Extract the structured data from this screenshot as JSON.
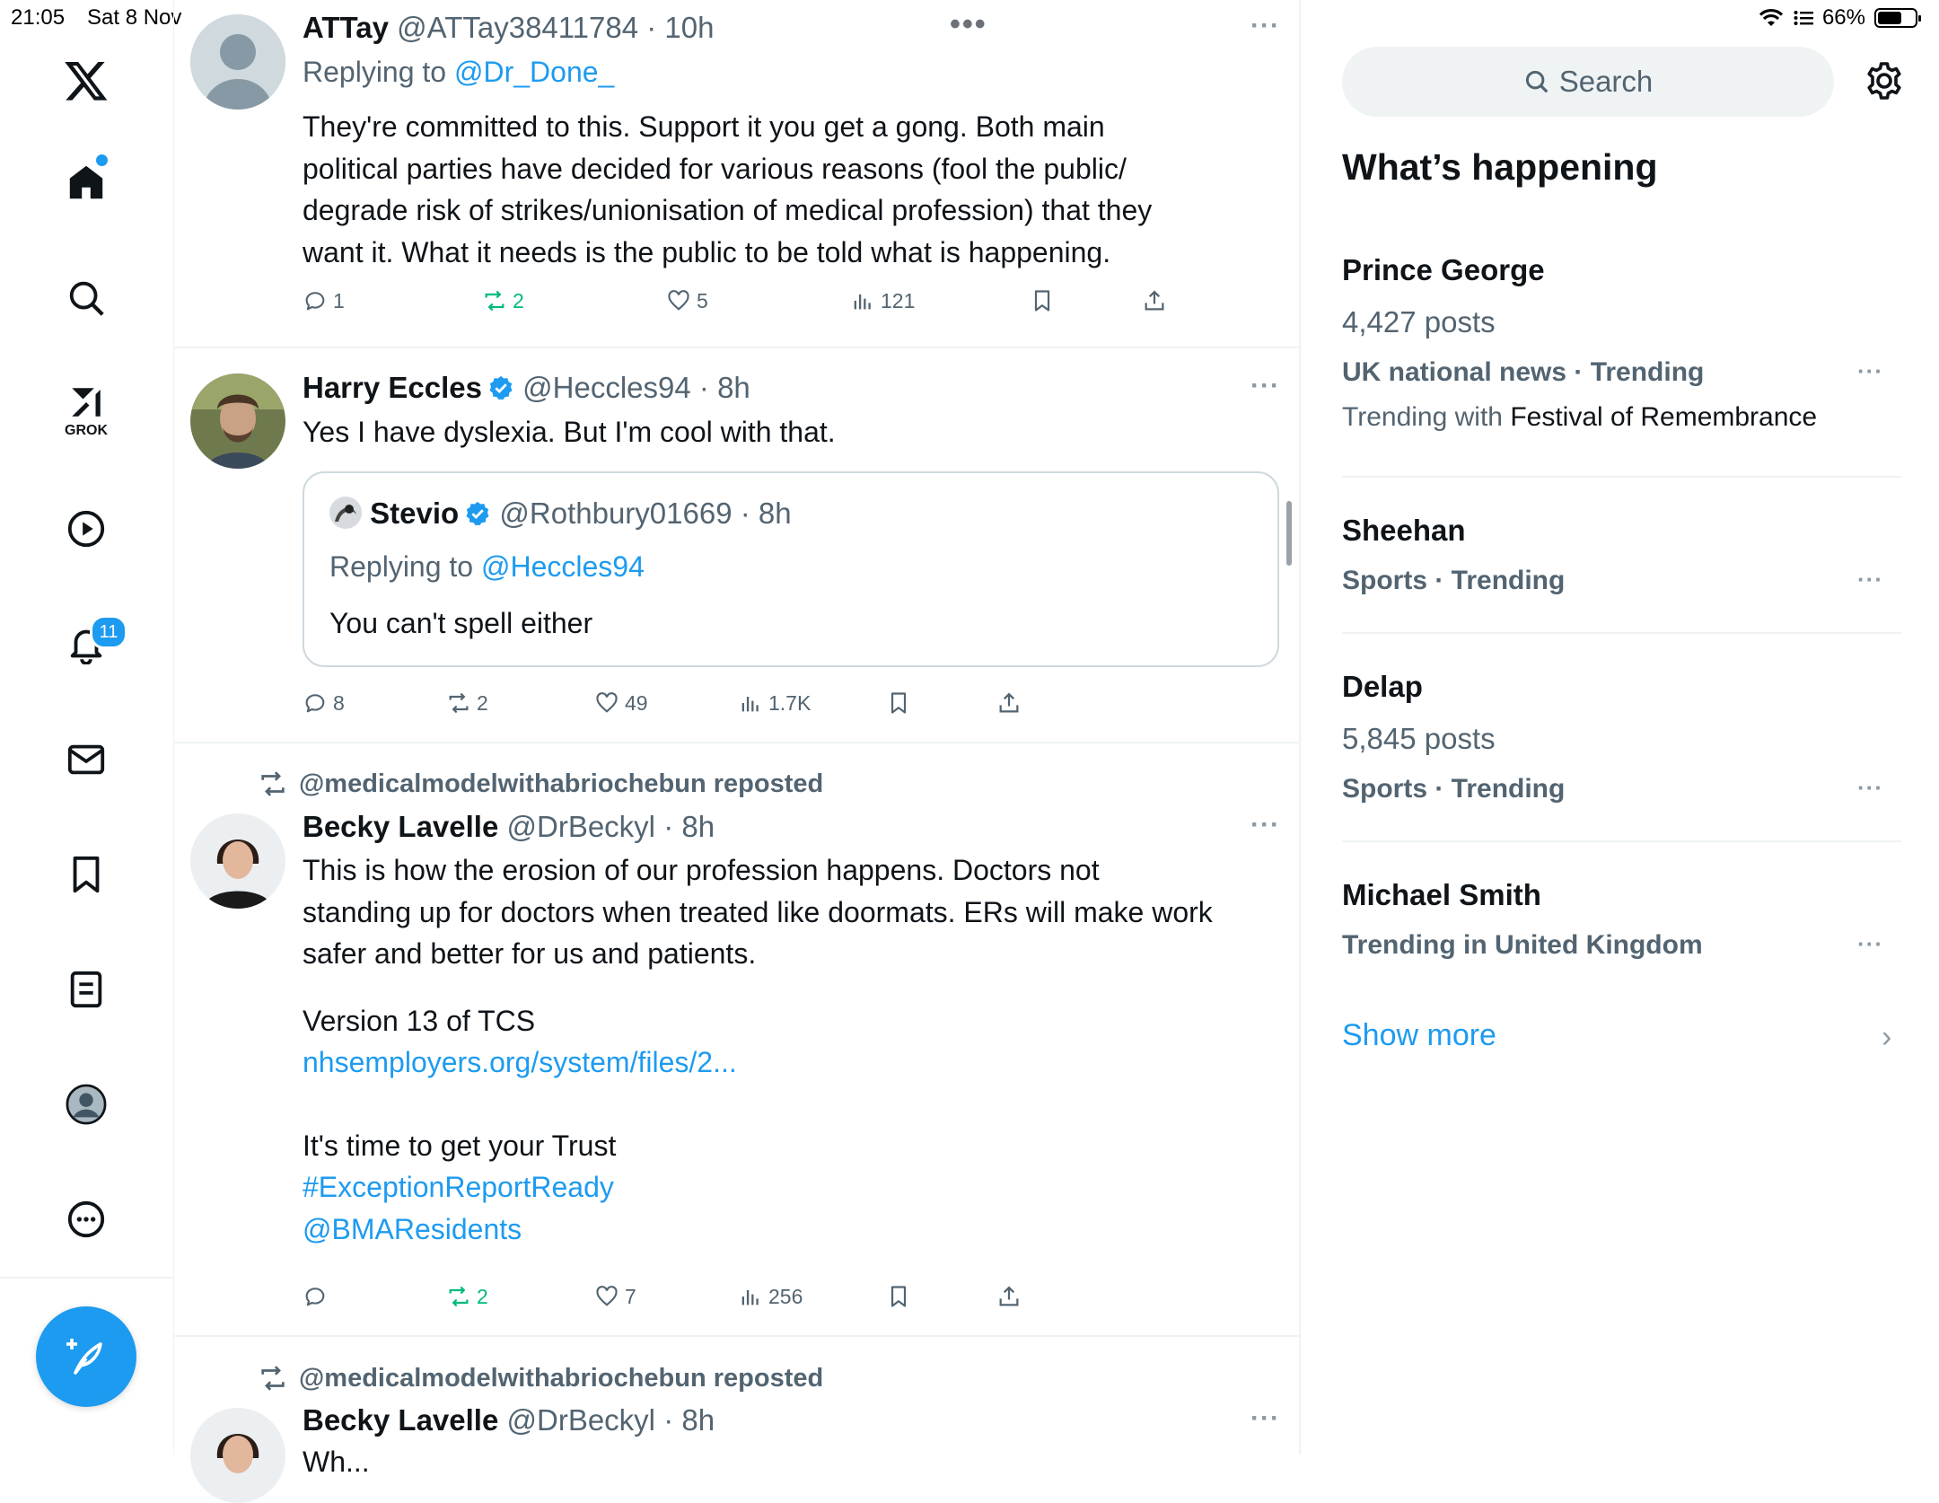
{
  "status": {
    "time": "21:05",
    "date": "Sat 8 Nov",
    "battery": "66%"
  },
  "top_more": "•••",
  "nav": {
    "grok_label": "GROK",
    "notifications_badge": "11"
  },
  "posts": [
    {
      "name": "ATTay",
      "handle": "@ATTay38411784",
      "time": "· 10h",
      "reply_prefix": "Replying to ",
      "reply_to": "@Dr_Done_",
      "lines": [
        "They're committed to this.  Support it you get a gong. Both main",
        "political parties have decided for various reasons (fool the public/",
        "degrade risk of strikes/unionisation of medical profession) that they",
        "want it.  What it needs is the public to be told what is happening."
      ],
      "replies": "1",
      "reposts": "2",
      "likes": "5",
      "views": "121"
    },
    {
      "name": "Harry Eccles",
      "handle": "@Heccles94",
      "time": "· 8h",
      "text": "Yes I have dyslexia. But I'm cool with that.",
      "quote": {
        "name": "Stevio",
        "handle": "@Rothbury01669",
        "time": "· 8h",
        "reply_prefix": "Replying to ",
        "reply_to": "@Heccles94",
        "text": "You can't spell either"
      },
      "replies": "8",
      "reposts": "2",
      "likes": "49",
      "views": "1.7K"
    },
    {
      "repost_by": "@medicalmodelwithabriochebun reposted",
      "name": "Becky Lavelle",
      "handle": "@DrBeckyl",
      "time": "· 8h",
      "lines": [
        "This is how the erosion of our profession happens. Doctors not",
        "standing up for doctors when treated like doormats. ERs will make work",
        "safer and better for us and patients."
      ],
      "line_version": "Version 13 of TCS",
      "link": "nhsemployers.org/system/files/2...",
      "line_trust": "It's time to get your Trust",
      "hashtag": "#ExceptionReportReady",
      "mention": "@BMAResidents",
      "reposts": "2",
      "likes": "7",
      "views": "256"
    },
    {
      "repost_by": "@medicalmodelwithabriochebun reposted",
      "name": "Becky Lavelle",
      "handle": "@DrBeckyl",
      "time": "· 8h",
      "partial_text": "Wh..."
    }
  ],
  "sidebar": {
    "search_placeholder": "Search",
    "heading": "What’s happening",
    "trends": [
      {
        "title": "Prince George",
        "posts": "4,427 posts",
        "category": "UK national news · Trending",
        "with_prefix": "Trending with ",
        "with_topic": "Festival of Remembrance"
      },
      {
        "title": "Sheehan",
        "category": "Sports · Trending"
      },
      {
        "title": "Delap",
        "posts": "5,845 posts",
        "category": "Sports · Trending"
      },
      {
        "title": "Michael Smith",
        "category": "Trending in United Kingdom"
      }
    ],
    "show_more": "Show more"
  },
  "colors": {
    "accent": "#1d9bf0",
    "repost_green": "#00ba7c",
    "muted": "#536471"
  }
}
